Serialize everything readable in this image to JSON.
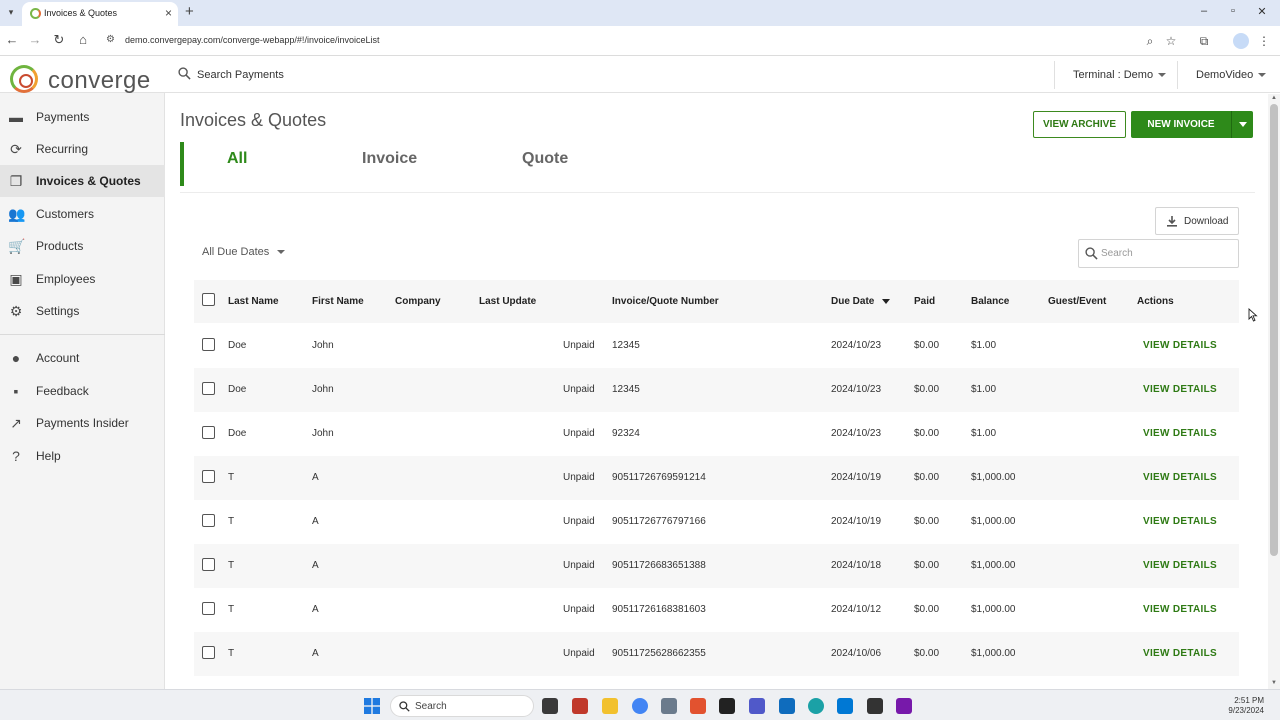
{
  "browser": {
    "tab_title": "Invoices & Quotes",
    "url": "demo.convergepay.com/converge-webapp/#!/invoice/invoiceList"
  },
  "header": {
    "logo_text": "converge",
    "search_label": "Search Payments",
    "terminal_label": "Terminal : Demo",
    "user_label": "DemoVideo"
  },
  "sidebar": {
    "items": [
      {
        "label": "Payments",
        "icon": "credit-card-icon"
      },
      {
        "label": "Recurring",
        "icon": "refresh-icon"
      },
      {
        "label": "Invoices & Quotes",
        "icon": "copy-icon",
        "active": true
      },
      {
        "label": "Customers",
        "icon": "people-icon"
      },
      {
        "label": "Products",
        "icon": "cart-icon"
      },
      {
        "label": "Employees",
        "icon": "badge-icon"
      },
      {
        "label": "Settings",
        "icon": "gear-icon"
      }
    ],
    "secondary": [
      {
        "label": "Account",
        "icon": "account-icon"
      },
      {
        "label": "Feedback",
        "icon": "feedback-icon"
      },
      {
        "label": "Payments Insider",
        "icon": "external-link-icon"
      },
      {
        "label": "Help",
        "icon": "help-icon"
      }
    ]
  },
  "main": {
    "title": "Invoices & Quotes",
    "view_archive_label": "VIEW ARCHIVE",
    "new_invoice_label": "NEW INVOICE",
    "tabs": [
      {
        "label": "All",
        "active": true
      },
      {
        "label": "Invoice"
      },
      {
        "label": "Quote"
      }
    ],
    "download_label": "Download",
    "due_filter_label": "All Due Dates",
    "search_placeholder": "Search"
  },
  "table": {
    "columns": {
      "last_name": "Last Name",
      "first_name": "First Name",
      "company": "Company",
      "last_update": "Last Update",
      "number": "Invoice/Quote Number",
      "due_date": "Due Date",
      "paid": "Paid",
      "balance": "Balance",
      "guest_event": "Guest/Event",
      "actions": "Actions"
    },
    "action_label": "VIEW DETAILS",
    "rows": [
      {
        "last": "Doe",
        "first": "John",
        "company": "",
        "status": "Unpaid",
        "number": "12345",
        "due": "2024/10/23",
        "paid": "$0.00",
        "balance": "$1.00",
        "guest": ""
      },
      {
        "last": "Doe",
        "first": "John",
        "company": "",
        "status": "Unpaid",
        "number": "12345",
        "due": "2024/10/23",
        "paid": "$0.00",
        "balance": "$1.00",
        "guest": ""
      },
      {
        "last": "Doe",
        "first": "John",
        "company": "",
        "status": "Unpaid",
        "number": "92324",
        "due": "2024/10/23",
        "paid": "$0.00",
        "balance": "$1.00",
        "guest": ""
      },
      {
        "last": "T",
        "first": "A",
        "company": "",
        "status": "Unpaid",
        "number": "90511726769591214",
        "due": "2024/10/19",
        "paid": "$0.00",
        "balance": "$1,000.00",
        "guest": ""
      },
      {
        "last": "T",
        "first": "A",
        "company": "",
        "status": "Unpaid",
        "number": "90511726776797166",
        "due": "2024/10/19",
        "paid": "$0.00",
        "balance": "$1,000.00",
        "guest": ""
      },
      {
        "last": "T",
        "first": "A",
        "company": "",
        "status": "Unpaid",
        "number": "90511726683651388",
        "due": "2024/10/18",
        "paid": "$0.00",
        "balance": "$1,000.00",
        "guest": ""
      },
      {
        "last": "T",
        "first": "A",
        "company": "",
        "status": "Unpaid",
        "number": "90511726168381603",
        "due": "2024/10/12",
        "paid": "$0.00",
        "balance": "$1,000.00",
        "guest": ""
      },
      {
        "last": "T",
        "first": "A",
        "company": "",
        "status": "Unpaid",
        "number": "90511725628662355",
        "due": "2024/10/06",
        "paid": "$0.00",
        "balance": "$1,000.00",
        "guest": ""
      }
    ]
  },
  "taskbar": {
    "search_label": "Search",
    "time": "2:51 PM",
    "date": "9/23/2024"
  },
  "colors": {
    "brand_green": "#2e8a1a",
    "link_green": "#2e7a14"
  }
}
